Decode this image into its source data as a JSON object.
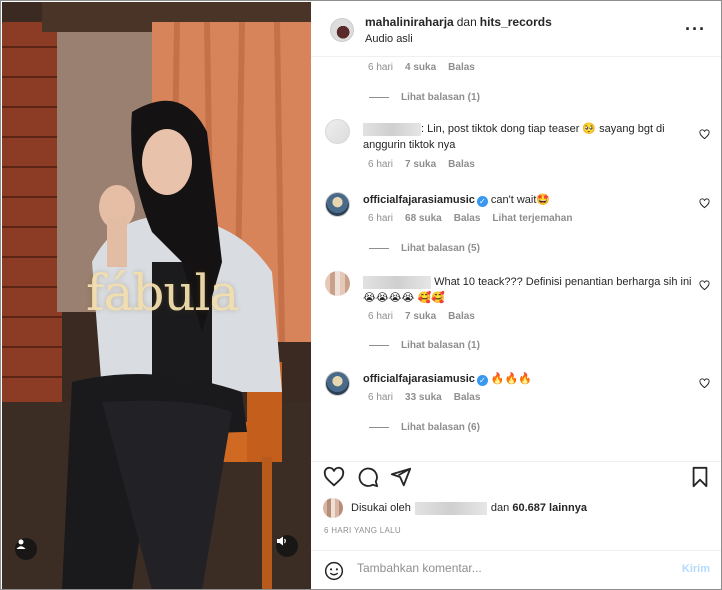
{
  "post": {
    "overlay_title": "fábula",
    "authors": {
      "primary": "mahaliniraharja",
      "joiner": "dan",
      "secondary": "hits_records"
    },
    "audio": "Audio asli"
  },
  "comments": {
    "top_meta": {
      "time": "6 hari",
      "likes": "4 suka",
      "reply": "Balas"
    },
    "top_replies": "Lihat balasan (1)",
    "c1": {
      "text": ": Lin, post tiktok dong tiap teaser 🥺 sayang bgt di anggurin tiktok nya",
      "time": "6 hari",
      "likes": "7 suka",
      "reply": "Balas"
    },
    "c2": {
      "user": "officialfajarasiamusic",
      "text": "can't wait🤩",
      "time": "6 hari",
      "likes": "68 suka",
      "reply": "Balas",
      "translate": "Lihat terjemahan",
      "replies": "Lihat balasan (5)"
    },
    "c3": {
      "text": "What 10 teack??? Definisi penantian berharga sih ini 😭😭😭😭 🥰🥰",
      "time": "6 hari",
      "likes": "7 suka",
      "reply": "Balas",
      "replies": "Lihat balasan (1)"
    },
    "c4": {
      "user": "officialfajarasiamusic",
      "text": "🔥🔥🔥",
      "time": "6 hari",
      "likes": "33 suka",
      "reply": "Balas",
      "replies": "Lihat balasan (6)"
    }
  },
  "likes": {
    "prefix": "Disukai oleh",
    "and": "dan",
    "count": "60.687 lainnya"
  },
  "timestamp": "6 HARI YANG LALU",
  "add_comment": {
    "placeholder": "Tambahkan komentar...",
    "send": "Kirim"
  },
  "colors": {
    "accent": "#3897f0",
    "send_disabled": "#b3dbff",
    "muted": "#8e8e8e"
  }
}
